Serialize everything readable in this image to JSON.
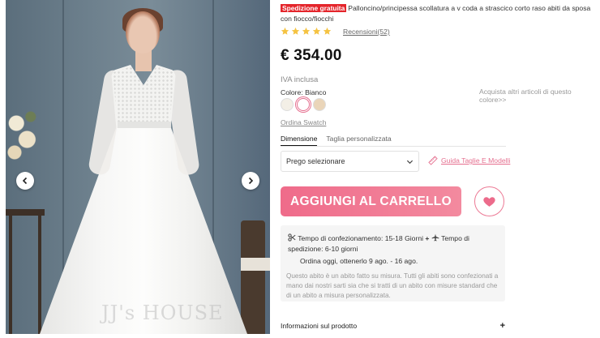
{
  "product": {
    "shipping_badge": "Spedizione gratuita",
    "title": "Palloncino/principessa scollatura a v coda a strascico corto raso abiti da sposa con fiocco/fiocchi",
    "rating_stars": 5,
    "reviews_label": "Recensioni(52)",
    "price": "€  354.00",
    "vat_label": "IVA inclusa",
    "color_label": "Colore: Bianco",
    "more_link": "Acquista altri articoli di questo colore>>",
    "swatches": [
      {
        "name": "Avorio",
        "color": "#f3efe6"
      },
      {
        "name": "Bianco",
        "color": "#ffffff",
        "selected": true
      },
      {
        "name": "Champagne",
        "color": "#ead5b9"
      }
    ],
    "order_swatch": "Ordina Swatch"
  },
  "watermark": "JJ's HOUSE",
  "tabs": {
    "size": "Dimensione",
    "custom": "Taglia personalizzata"
  },
  "size_select": {
    "placeholder": "Prego selezionare"
  },
  "size_guide": "Guida Taglie E Modelli",
  "actions": {
    "add_to_cart": "AGGIUNGI AL CARRELLO"
  },
  "info_box": {
    "production": "Tempo di confezionamento: 15-18 Giorni",
    "shipping": "Tempo di spedizione: 6-10 giorni",
    "order_today": "Ordina oggi, ottenerlo  9 ago. - 16 ago.",
    "note": "Questo abito è un abito fatto su misura. Tutti gli abiti sono confezionati a mano dai nostri sarti sia che si tratti di un abito con misure standard che di un abito a misura personalizzata."
  },
  "details_label": "Informazioni sul prodotto",
  "colors": {
    "accent": "#ef6b8a",
    "badge": "#e4252b",
    "star": "#f5c342"
  }
}
